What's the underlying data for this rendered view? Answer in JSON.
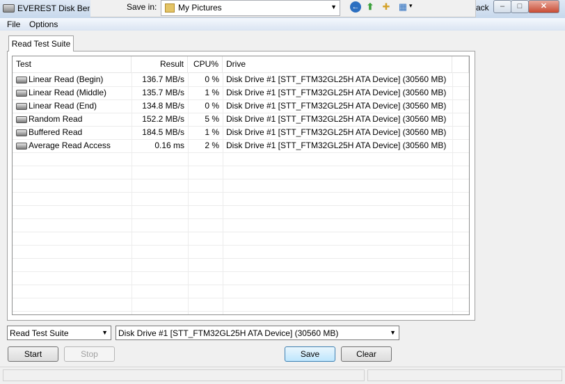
{
  "window": {
    "title": "EVEREST Disk Benchmark",
    "title_fragment_right": "ack",
    "min_glyph": "–",
    "max_glyph": "□",
    "close_glyph": "✕"
  },
  "save_dialog": {
    "label": "Save in:",
    "location": "My Pictures",
    "arrow": "▼"
  },
  "menu": [
    "File",
    "Options"
  ],
  "tab": {
    "label": "Read Test Suite"
  },
  "table": {
    "headers": [
      "Test",
      "Result",
      "CPU%",
      "Drive"
    ],
    "rows": [
      {
        "test": "Linear Read (Begin)",
        "result": "136.7 MB/s",
        "cpu": "0 %",
        "drive": "Disk Drive #1  [STT_FTM32GL25H ATA Device]  (30560 MB)"
      },
      {
        "test": "Linear Read (Middle)",
        "result": "135.7 MB/s",
        "cpu": "1 %",
        "drive": "Disk Drive #1  [STT_FTM32GL25H ATA Device]  (30560 MB)"
      },
      {
        "test": "Linear Read (End)",
        "result": "134.8 MB/s",
        "cpu": "0 %",
        "drive": "Disk Drive #1  [STT_FTM32GL25H ATA Device]  (30560 MB)"
      },
      {
        "test": "Random Read",
        "result": "152.2 MB/s",
        "cpu": "5 %",
        "drive": "Disk Drive #1  [STT_FTM32GL25H ATA Device]  (30560 MB)"
      },
      {
        "test": "Buffered Read",
        "result": "184.5 MB/s",
        "cpu": "1 %",
        "drive": "Disk Drive #1  [STT_FTM32GL25H ATA Device]  (30560 MB)"
      },
      {
        "test": "Average Read Access",
        "result": "0.16 ms",
        "cpu": "2 %",
        "drive": "Disk Drive #1  [STT_FTM32GL25H ATA Device]  (30560 MB)"
      }
    ]
  },
  "suite_select": {
    "value": "Read Test Suite",
    "arrow": "▼"
  },
  "drive_select": {
    "value": "Disk Drive #1  [STT_FTM32GL25H ATA Device]  (30560 MB)",
    "arrow": "▼"
  },
  "buttons": {
    "start": "Start",
    "stop": "Stop",
    "save": "Save",
    "clear": "Clear"
  },
  "icons": {
    "back": "←",
    "up": "⬆",
    "new_folder": "✚",
    "views": "▦",
    "views_arrow": "▾"
  }
}
